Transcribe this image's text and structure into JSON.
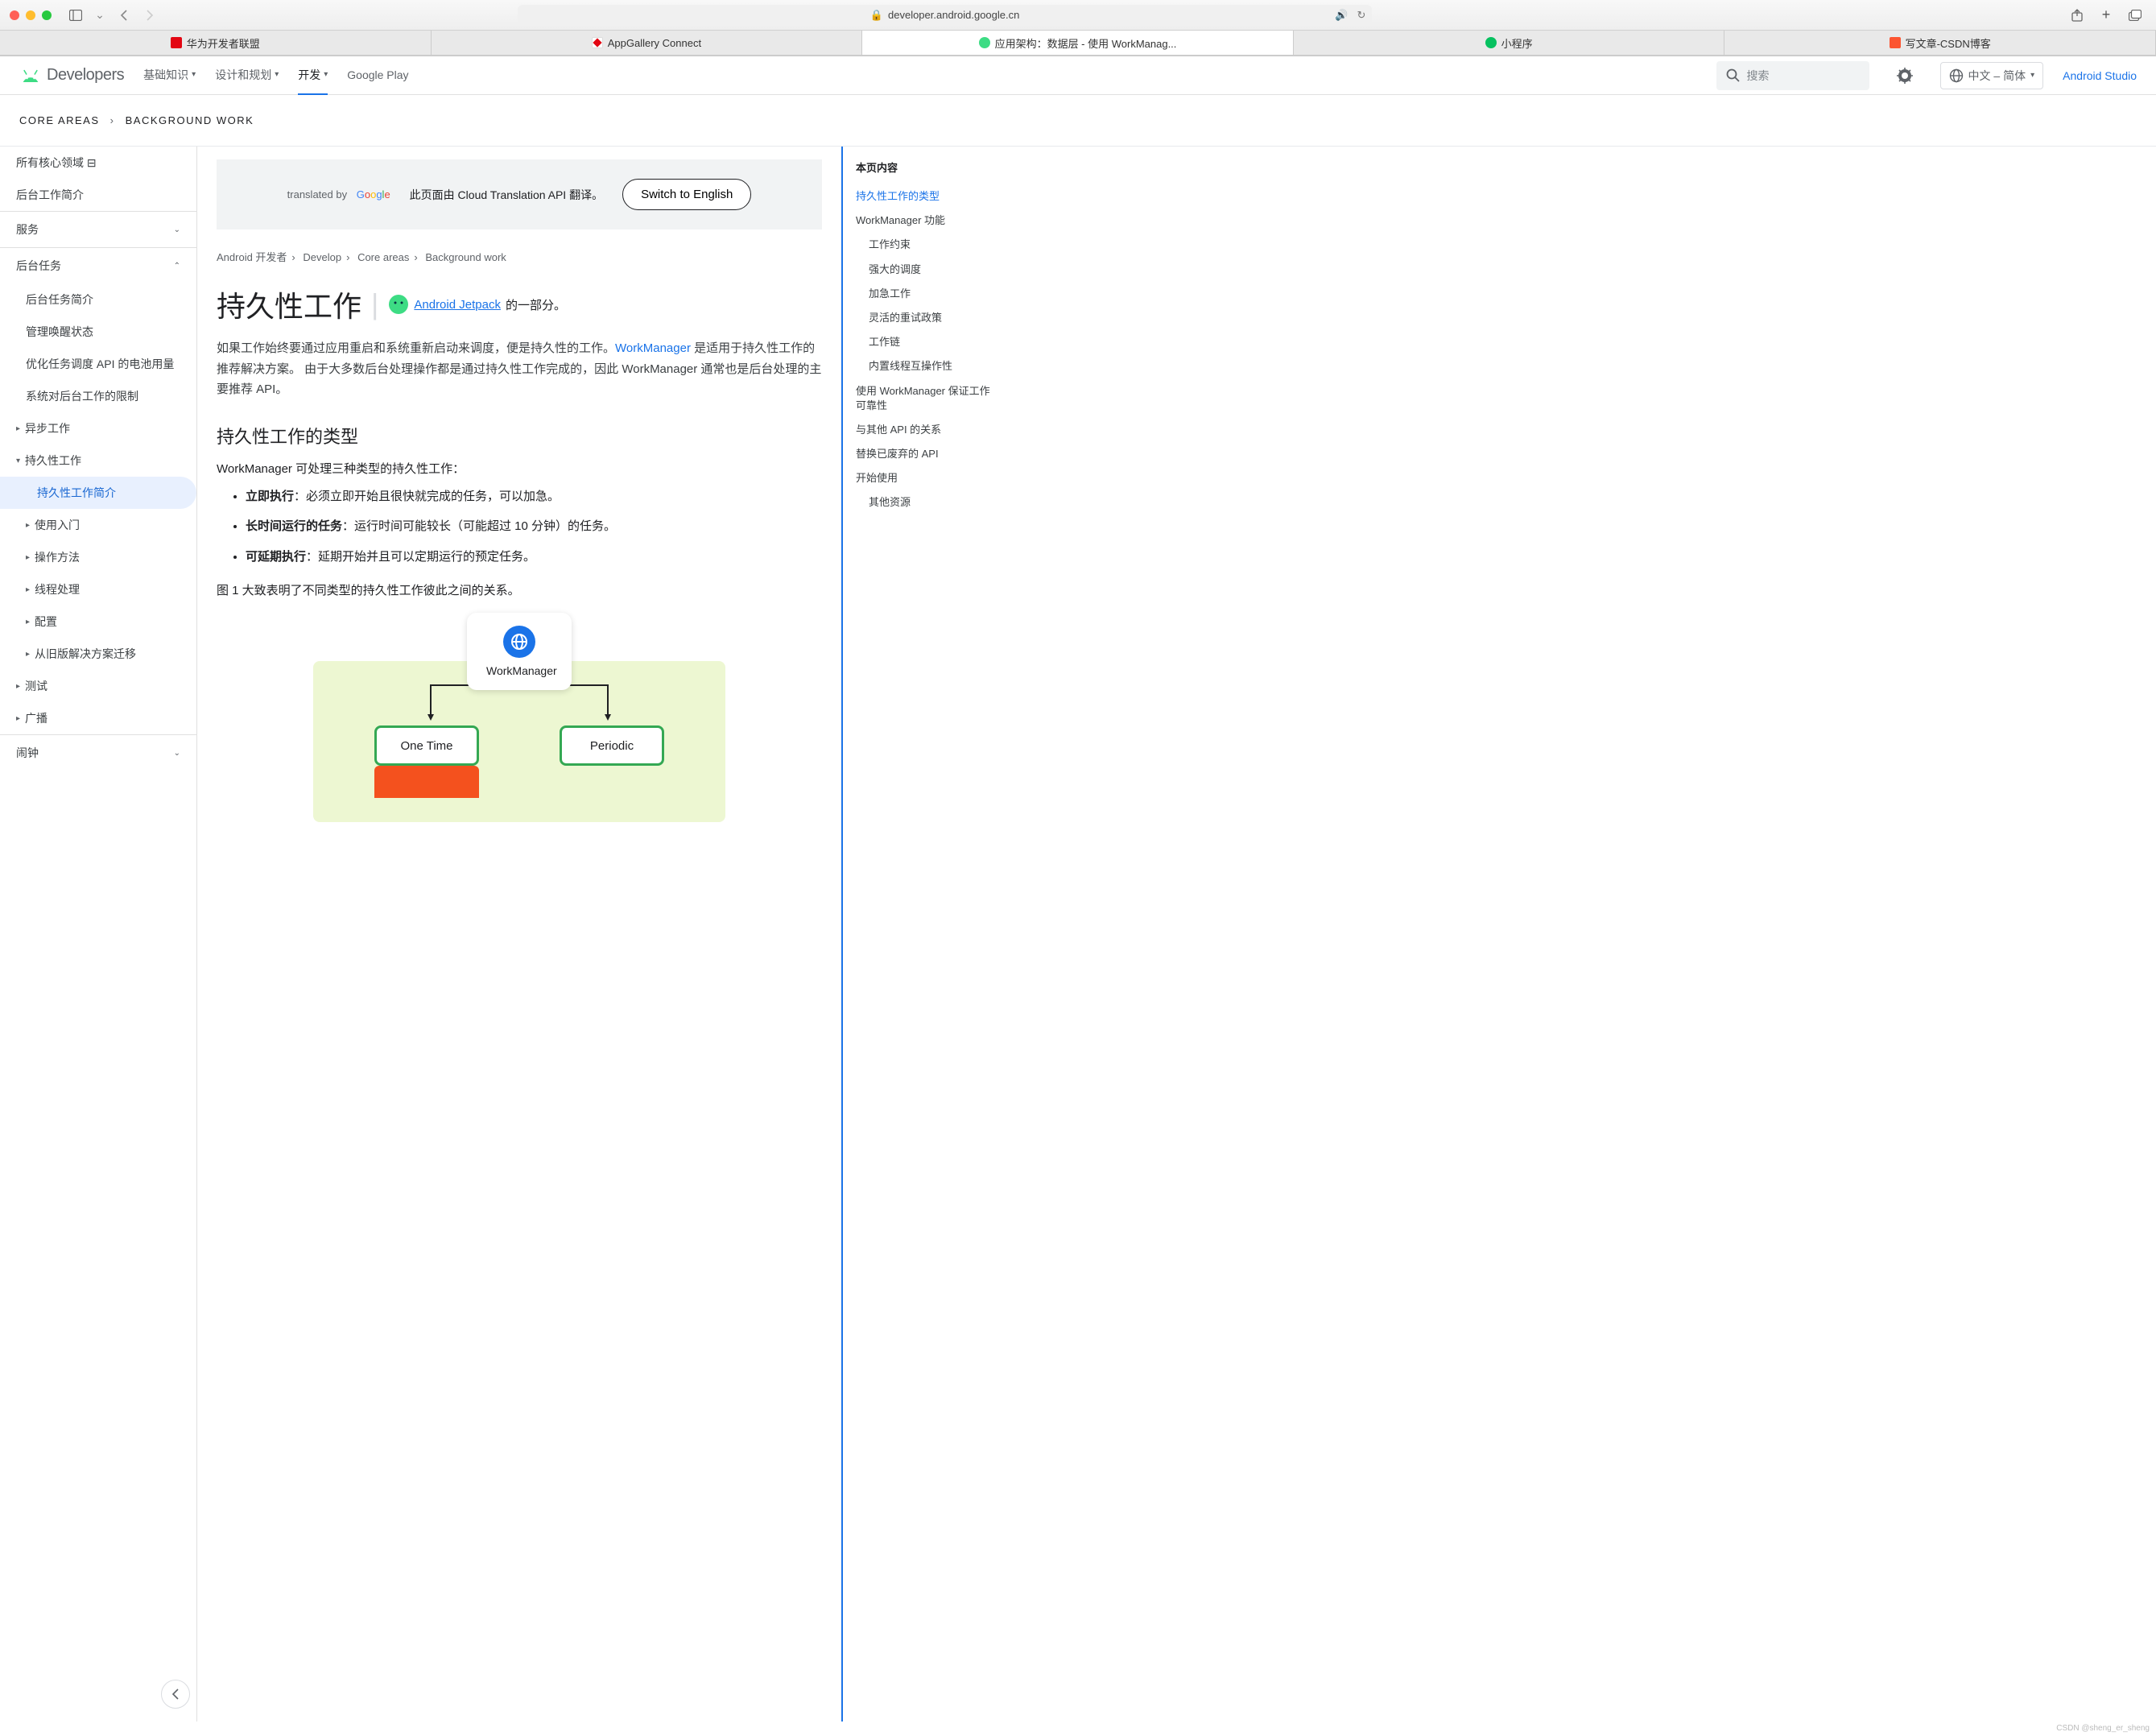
{
  "browser": {
    "url": "developer.android.google.cn",
    "tabs": [
      {
        "label": "华为开发者联盟",
        "favicon": "huawei"
      },
      {
        "label": "AppGallery Connect",
        "favicon": "appgallery"
      },
      {
        "label": "应用架构：数据层 - 使用 WorkManag...",
        "favicon": "android",
        "active": true
      },
      {
        "label": "小程序",
        "favicon": "wechat"
      },
      {
        "label": "写文章-CSDN博客",
        "favicon": "csdn"
      }
    ]
  },
  "header": {
    "logo_text": "Developers",
    "nav": [
      {
        "label": "基础知识",
        "dropdown": true
      },
      {
        "label": "设计和规划",
        "dropdown": true
      },
      {
        "label": "开发",
        "dropdown": true,
        "active": true
      },
      {
        "label": "Google Play",
        "dropdown": false
      }
    ],
    "search_placeholder": "搜索",
    "language": "中文 – 简体",
    "studio": "Android Studio"
  },
  "breadcrumb_top": [
    "CORE AREAS",
    "BACKGROUND WORK"
  ],
  "sidebar": {
    "items_top": [
      "所有核心领域 ⊟",
      "后台工作简介"
    ],
    "group1_label": "服务",
    "group2_label": "后台任务",
    "group2_items": [
      "后台任务简介",
      "管理唤醒状态",
      "优化任务调度 API 的电池用量",
      "系统对后台工作的限制"
    ],
    "async_label": "异步工作",
    "persistent_label": "持久性工作",
    "persistent_items": [
      {
        "label": "持久性工作简介",
        "active": true
      },
      {
        "label": "使用入门",
        "expandable": true
      },
      {
        "label": "操作方法",
        "expandable": true
      },
      {
        "label": "线程处理",
        "expandable": true
      },
      {
        "label": "配置",
        "expandable": true
      },
      {
        "label": "从旧版解决方案迁移",
        "expandable": true
      }
    ],
    "test_label": "测试",
    "broadcast_label": "广播",
    "alarm_label": "闹钟"
  },
  "content": {
    "translate_by": "translated by",
    "translate_msg": "此页面由 Cloud Translation API 翻译。",
    "switch_btn": "Switch to English",
    "inner_breadcrumb": [
      "Android 开发者",
      "Develop",
      "Core areas",
      "Background work"
    ],
    "h1": "持久性工作",
    "jetpack_link": "Android Jetpack",
    "jetpack_suffix": " 的一部分。",
    "intro_p_1": "如果工作始终要通过应用重启和系统重新启动来调度，便是持久性的工作。",
    "intro_link": "WorkManager",
    "intro_p_2": " 是适用于持久性工作的推荐解决方案。 由于大多数后台处理操作都是通过持久性工作完成的，因此 WorkManager 通常也是后台处理的主要推荐 API。",
    "h2": "持久性工作的类型",
    "lead": "WorkManager 可处理三种类型的持久性工作：",
    "bullets": [
      {
        "b": "立即执行",
        "rest": "：必须立即开始且很快就完成的任务，可以加急。"
      },
      {
        "b": "长时间运行的任务",
        "rest": "：运行时间可能较长（可能超过 10 分钟）的任务。"
      },
      {
        "b": "可延期执行",
        "rest": "：延期开始并且可以定期运行的预定任务。"
      }
    ],
    "fig_desc": "图 1 大致表明了不同类型的持久性工作彼此之间的关系。",
    "diagram": {
      "wm": "WorkManager",
      "onetime": "One Time",
      "periodic": "Periodic"
    }
  },
  "toc": {
    "title": "本页内容",
    "items": [
      {
        "label": "持久性工作的类型",
        "active": true
      },
      {
        "label": "WorkManager 功能"
      },
      {
        "label": "工作约束",
        "sub": true
      },
      {
        "label": "强大的调度",
        "sub": true
      },
      {
        "label": "加急工作",
        "sub": true
      },
      {
        "label": "灵活的重试政策",
        "sub": true
      },
      {
        "label": "工作链",
        "sub": true
      },
      {
        "label": "内置线程互操作性",
        "sub": true
      },
      {
        "label": "使用 WorkManager 保证工作可靠性"
      },
      {
        "label": "与其他 API 的关系"
      },
      {
        "label": "替换已废弃的 API"
      },
      {
        "label": "开始使用"
      },
      {
        "label": "其他资源",
        "sub": true
      }
    ]
  },
  "watermark": "CSDN @sheng_er_sheng"
}
